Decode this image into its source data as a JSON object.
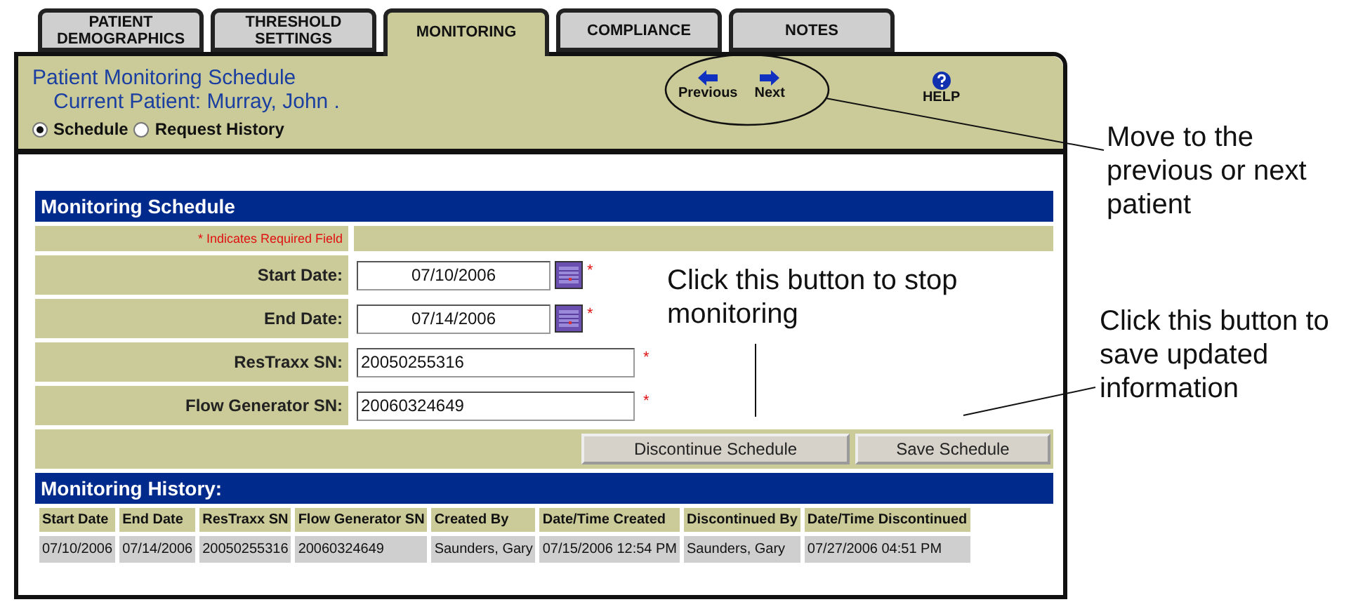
{
  "tabs": [
    {
      "label": "PATIENT DEMOGRAPHICS",
      "selected": false
    },
    {
      "label": "THRESHOLD SETTINGS",
      "selected": false
    },
    {
      "label": "MONITORING",
      "selected": true
    },
    {
      "label": "COMPLIANCE",
      "selected": false
    },
    {
      "label": "NOTES",
      "selected": false
    }
  ],
  "header": {
    "title": "Patient Monitoring Schedule",
    "current_patient": "Current Patient: Murray, John .",
    "views": [
      {
        "label": "Schedule",
        "selected": true
      },
      {
        "label": "Request History",
        "selected": false
      }
    ],
    "nav": [
      {
        "label": "Previous",
        "kind": "previous"
      },
      {
        "label": "Next",
        "kind": "next"
      }
    ],
    "help": "HELP"
  },
  "schedule": {
    "title": "Monitoring Schedule",
    "required_note": "* Indicates Required Field",
    "fields": [
      {
        "label": "Start Date:",
        "value": "07/10/2006",
        "kind": "date",
        "required_mark": "*"
      },
      {
        "label": "End Date:",
        "value": "07/14/2006",
        "kind": "date",
        "required_mark": "*"
      },
      {
        "label": "ResTraxx SN:",
        "value": "20050255316",
        "kind": "text",
        "required_mark": "*"
      },
      {
        "label": "Flow Generator SN:",
        "value": "20060324649",
        "kind": "text",
        "required_mark": "*"
      }
    ],
    "buttons": [
      "Discontinue Schedule",
      "Save Schedule"
    ]
  },
  "history": {
    "title": "Monitoring History:",
    "columns": [
      "Start Date",
      "End Date",
      "ResTraxx SN",
      "Flow Generator SN",
      "Created By",
      "Date/Time Created",
      "Discontinued By",
      "Date/Time Discontinued"
    ],
    "rows": [
      [
        "07/10/2006",
        "07/14/2006",
        "20050255316",
        "20060324649",
        "Saunders, Gary",
        "07/15/2006 12:54 PM",
        "Saunders, Gary",
        "07/27/2006 04:51 PM"
      ]
    ]
  },
  "annotations": [
    {
      "kind": "nav",
      "text": "Move to the previous or next patient"
    },
    {
      "kind": "discontinue",
      "text": "Click this button to stop monitoring"
    },
    {
      "kind": "save",
      "text": "Click this button to save updated information"
    }
  ]
}
